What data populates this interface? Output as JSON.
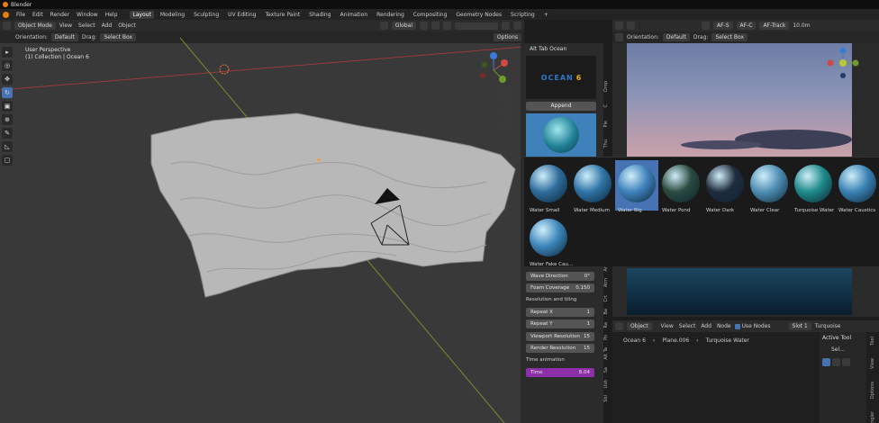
{
  "app": {
    "title": "Blender"
  },
  "menu": [
    "File",
    "Edit",
    "Render",
    "Window",
    "Help"
  ],
  "workspaces": [
    "Layout",
    "Modeling",
    "Sculpting",
    "UV Editing",
    "Texture Paint",
    "Shading",
    "Animation",
    "Rendering",
    "Compositing",
    "Geometry Nodes",
    "Scripting",
    "+"
  ],
  "active_workspace": "Layout",
  "viewport": {
    "mode": "Object Mode",
    "menus": [
      "View",
      "Select",
      "Add",
      "Object"
    ],
    "transform": "Global",
    "orientation_label": "Orientation:",
    "orientation": "Default",
    "drag_label": "Drag:",
    "drag": "Select Box",
    "info_line1": "User Perspective",
    "info_line2": "(1) Collection | Ocean 6",
    "options": "Options"
  },
  "addon": {
    "header": "Alt Tab Ocean",
    "logo_text": "OCEAN",
    "logo_num": "6",
    "append": "Append"
  },
  "preview_header": {
    "af_s": "AF-S",
    "af_c": "AF-C",
    "af_track": "AF-Track",
    "distance": "10.0m",
    "orientation_label": "Orientation:",
    "orientation": "Default",
    "drag_label": "Drag:",
    "drag": "Select Box"
  },
  "side_tabs_left": [
    "Drop",
    "C",
    "Ple",
    "Thu",
    "Ope T"
  ],
  "side_tabs_lower": [
    "Ar",
    "Atm",
    "Crt",
    "Ba",
    "Ra",
    "Po",
    "Alt Ta",
    "Sa",
    "Usb",
    "Sbl"
  ],
  "materials": [
    {
      "name": "Water Small",
      "color": "#2f6d9c",
      "selected": false
    },
    {
      "name": "Water Medium",
      "color": "#2f74a8",
      "selected": false
    },
    {
      "name": "Water Big",
      "color": "#3f82bb",
      "selected": true
    },
    {
      "name": "Water Pond",
      "color": "#2a4a3e",
      "selected": false
    },
    {
      "name": "Water Dark",
      "color": "#1f2c3c",
      "selected": false
    },
    {
      "name": "Water Clear",
      "color": "#4d8db3",
      "selected": false
    },
    {
      "name": "Turquoise Water",
      "color": "#1f8a8a",
      "selected": false
    },
    {
      "name": "Water Caustics",
      "color": "#3a82b4",
      "selected": false
    },
    {
      "name": "Water Fake Cau...",
      "color": "#3d86bb",
      "selected": false
    }
  ],
  "props": {
    "wave_direction": {
      "label": "Wave Direction",
      "value": "0°"
    },
    "foam_coverage": {
      "label": "Foam Coverage",
      "value": "0.150"
    },
    "resolution_title": "Resolution and tiling",
    "repeat_x": {
      "label": "Repeat X",
      "value": "1"
    },
    "repeat_y": {
      "label": "Repeat Y",
      "value": "1"
    },
    "viewport_res": {
      "label": "Viewport Resolution",
      "value": "15"
    },
    "render_res": {
      "label": "Render Resolution",
      "value": "15"
    },
    "time_title": "Time animation",
    "time": {
      "label": "Time",
      "value": "8.04"
    }
  },
  "node_editor": {
    "type": "Object",
    "menus": [
      "View",
      "Select",
      "Add",
      "Node"
    ],
    "use_nodes": "Use Nodes",
    "slot": "Slot 1",
    "material": "Turquoise",
    "breadcrumb": [
      "Ocean 6",
      "Plane.006",
      "Turquoise Water"
    ]
  },
  "npanel": {
    "title": "Active Tool",
    "item": "Sel..."
  },
  "npanel_tabs": [
    "Tool",
    "View",
    "Options",
    "Wrangler"
  ],
  "gizmo": {
    "x": "X",
    "y": "Y",
    "z": "Z"
  }
}
